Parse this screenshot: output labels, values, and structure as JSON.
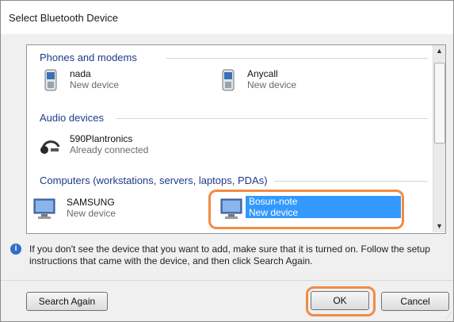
{
  "window": {
    "title": "Select Bluetooth Device"
  },
  "groups": {
    "phones": "Phones and modems",
    "audio": "Audio devices",
    "computers": "Computers (workstations, servers, laptops, PDAs)"
  },
  "devices": [
    {
      "name": "nada",
      "status": "New device",
      "icon": "phone-icon"
    },
    {
      "name": "Anycall",
      "status": "New device",
      "icon": "phone-icon"
    },
    {
      "name": "590Plantronics",
      "status": "Already connected",
      "icon": "headset-icon"
    },
    {
      "name": "SAMSUNG",
      "status": "New device",
      "icon": "computer-icon"
    },
    {
      "name": "Bosun-note",
      "status": "New device",
      "icon": "computer-icon",
      "selected": true
    }
  ],
  "info": {
    "text": "If you don't see the device that you want to add, make sure that it is turned on. Follow the setup instructions that came with the device, and then click Search Again."
  },
  "buttons": {
    "search_again": "Search Again",
    "ok": "OK",
    "cancel": "Cancel"
  },
  "colors": {
    "highlight": "#f28b45",
    "selection": "#3399ff",
    "group_header": "#1e3a8a"
  }
}
